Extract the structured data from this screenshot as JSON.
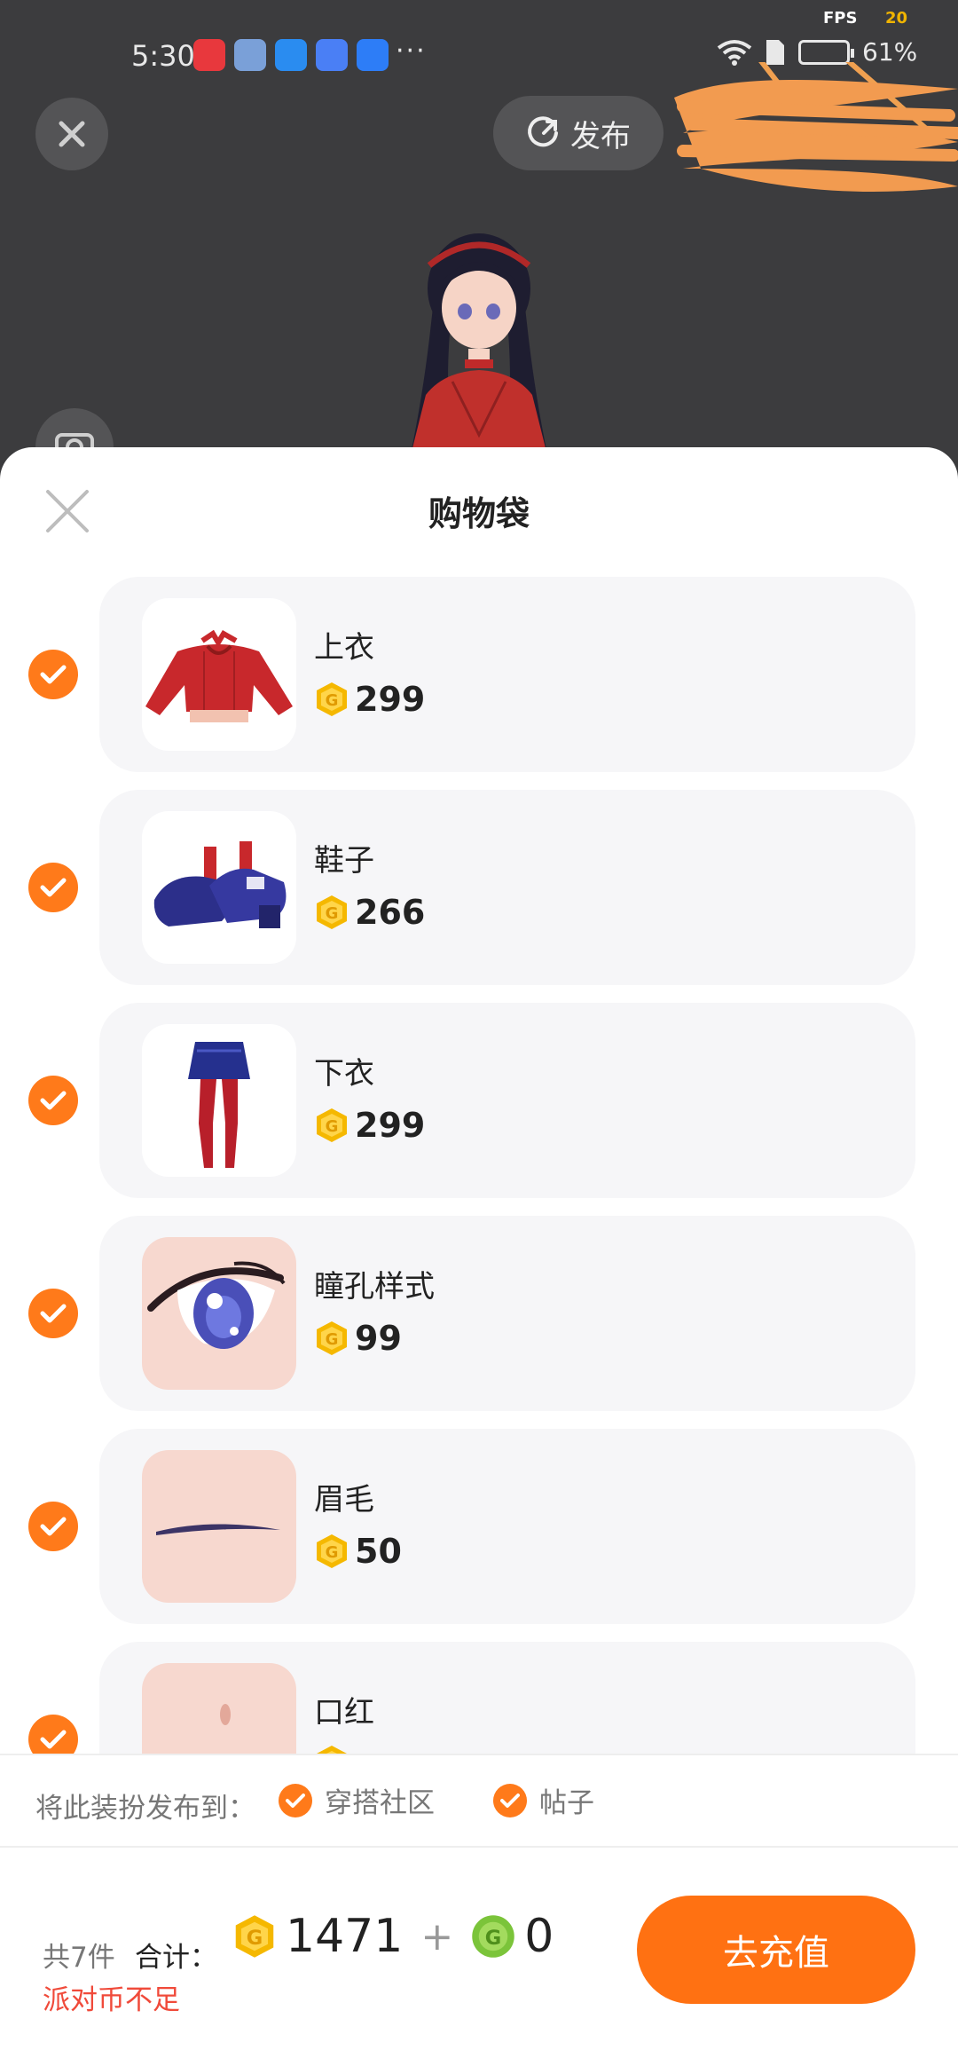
{
  "status_bar": {
    "time": "5:30",
    "more": "···",
    "fps_label": "FPS",
    "fps_value": "20",
    "battery_text": "61%"
  },
  "scene": {
    "publish_label": "发布"
  },
  "sheet": {
    "title": "购物袋",
    "items": [
      {
        "name": "上衣",
        "price": "299",
        "checked": true,
        "thumb": "red-sweater"
      },
      {
        "name": "鞋子",
        "price": "266",
        "checked": true,
        "thumb": "blue-shoes"
      },
      {
        "name": "下衣",
        "price": "299",
        "checked": true,
        "thumb": "skirt-stockings"
      },
      {
        "name": "瞳孔样式",
        "price": "99",
        "checked": true,
        "thumb": "eye"
      },
      {
        "name": "眉毛",
        "price": "50",
        "checked": true,
        "thumb": "eyebrow"
      },
      {
        "name": "口红",
        "price": "",
        "checked": true,
        "thumb": "lips"
      }
    ]
  },
  "publish_to": {
    "label": "将此装扮发布到：",
    "options": [
      {
        "label": "穿搭社区",
        "checked": true
      },
      {
        "label": "帖子",
        "checked": true
      }
    ]
  },
  "footer": {
    "count_label": "共7件",
    "total_label": "合计：",
    "gold_total": "1471",
    "plus": "+",
    "green_total": "0",
    "warning": "派对币不足",
    "recharge_label": "去充值"
  },
  "colors": {
    "accent": "#ff7112",
    "check": "#ff7a1a",
    "warning": "#f04a3a",
    "coin_gold": "#f5b800",
    "coin_green": "#7bc43a"
  }
}
